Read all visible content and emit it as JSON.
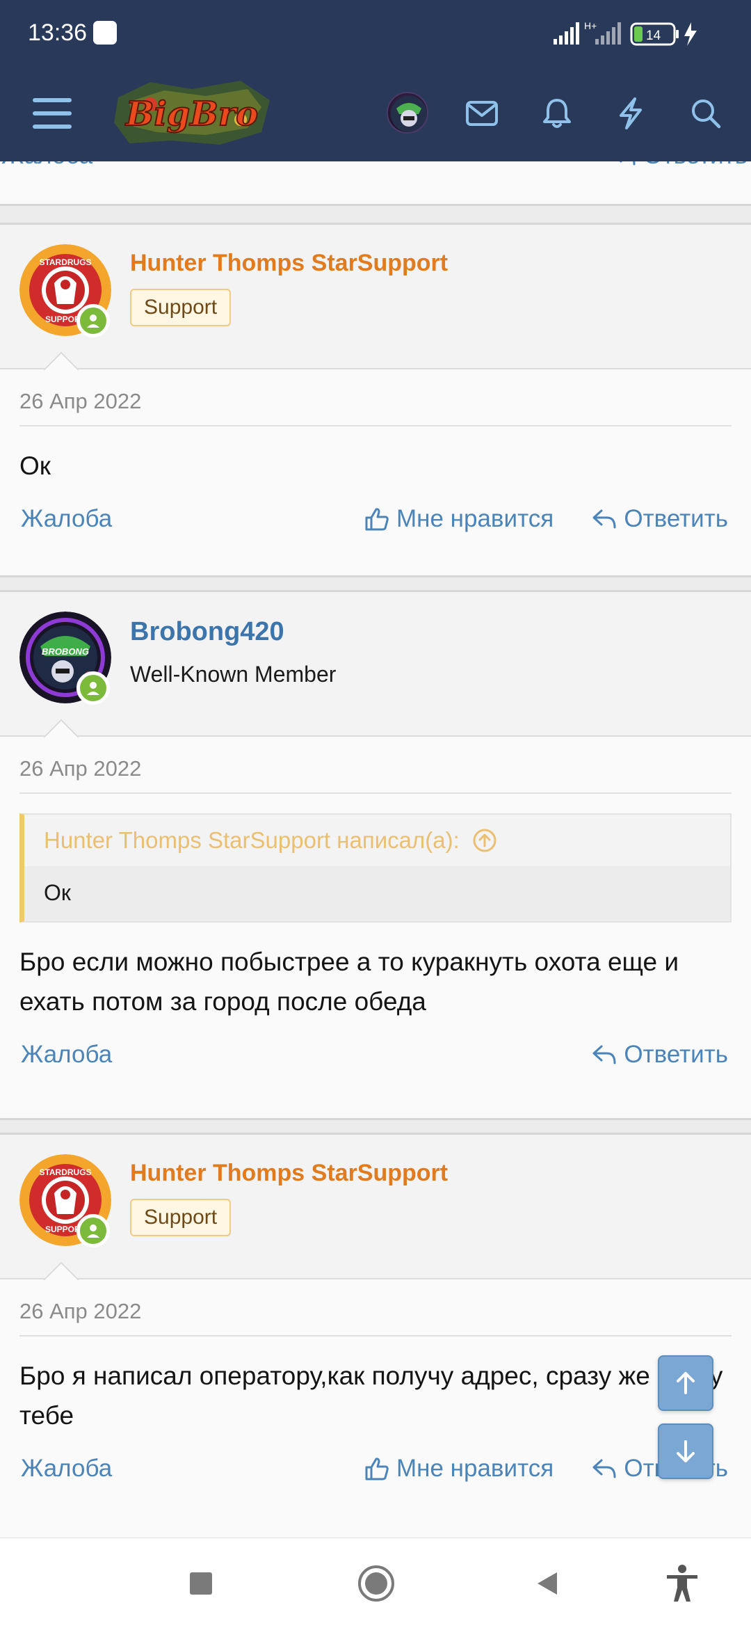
{
  "status_bar": {
    "time": "13:36",
    "network": "H+",
    "battery": "14"
  },
  "header": {
    "menu_icon": "hamburger-icon",
    "logo_text": "BigBro",
    "icons": [
      "avatar",
      "envelope-icon",
      "bell-icon",
      "lightning-icon",
      "search-icon"
    ]
  },
  "previous_post": {
    "report": "Жалоба",
    "reply": "Ответить"
  },
  "posts": [
    {
      "user": {
        "name": "Hunter Thomps StarSupport",
        "badge": "Support",
        "avatar_text": "STARDRUGS SUPPORT"
      },
      "date": "26 Апр 2022",
      "text": "Ок",
      "actions": {
        "report": "Жалоба",
        "like": "Мне нравится",
        "reply": "Ответить"
      }
    },
    {
      "user": {
        "name": "Brobong420",
        "title": "Well-Known Member",
        "avatar_text": "BROBONG"
      },
      "date": "26 Апр 2022",
      "quote": {
        "header": "Hunter Thomps StarSupport написал(а):",
        "body": "Ок"
      },
      "text": "Бро если можно побыстрее а то куракнуть охота еще и ехать потом за город после обеда",
      "actions": {
        "report": "Жалоба",
        "reply": "Ответить"
      }
    },
    {
      "user": {
        "name": "Hunter Thomps StarSupport",
        "badge": "Support",
        "avatar_text": "STARDRUGS SUPPORT"
      },
      "date": "26 Апр 2022",
      "text": "Бро я написал оператору,как получу адрес, сразу же скину тебе",
      "actions": {
        "report": "Жалоба",
        "like": "Мне нравится",
        "reply": "Ответить"
      }
    }
  ],
  "colors": {
    "header_bg": "#29395a",
    "support_name": "#e07b1f",
    "member_name": "#3c74ac",
    "link": "#4a84b8",
    "online": "#7cba3b",
    "quote_accent": "#f2c96a"
  }
}
